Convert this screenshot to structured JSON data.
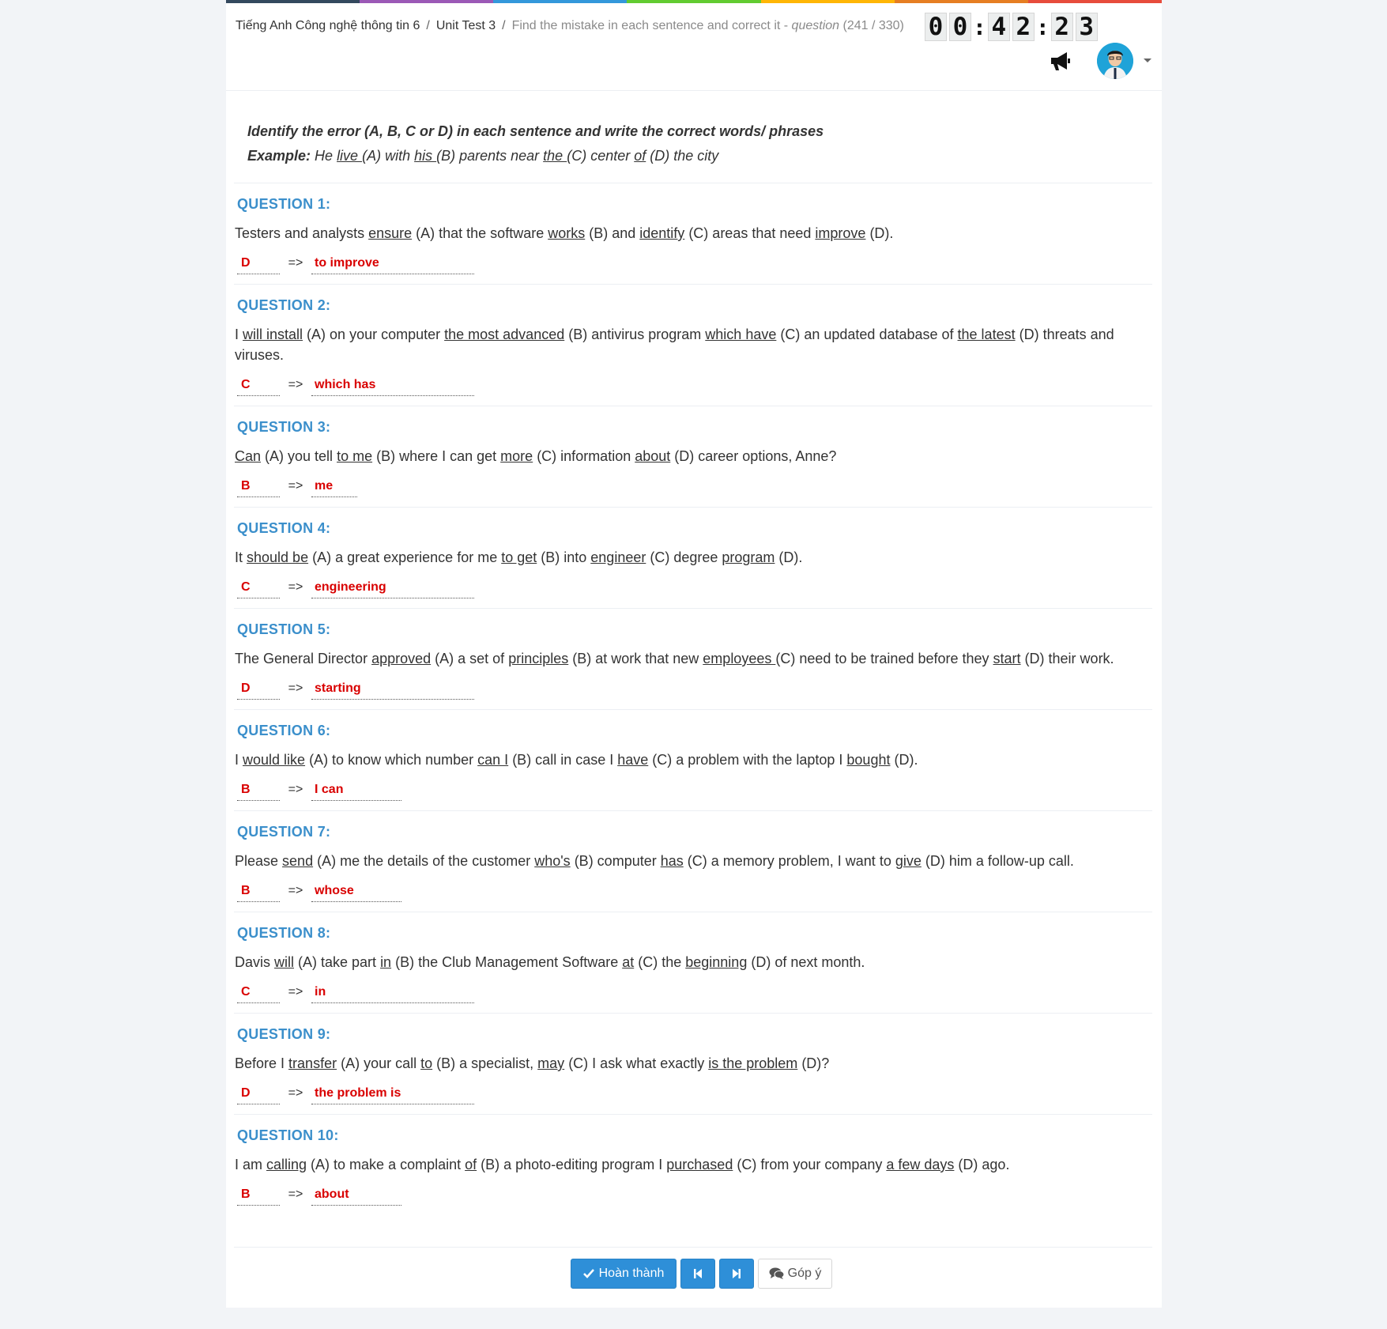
{
  "header": {
    "rainbow_colors": [
      "#34495e",
      "#9b59b6",
      "#3498db",
      "#62cb31",
      "#ffb606",
      "#e67e22",
      "#e74c3c"
    ],
    "breadcrumb": {
      "course": "Tiếng Anh Công nghệ thông tin 6",
      "unit": "Unit Test 3",
      "section": "Find the mistake in each sentence and correct it -",
      "section_italic": "question",
      "progress": "(241 / 330)"
    },
    "timer": {
      "hours": "00",
      "minutes": "42",
      "seconds": "23"
    }
  },
  "instructions": {
    "heading": "Identify the error (A, B, C or D) in each sentence and write the correct words/ phrases",
    "example_label": "Example:"
  },
  "questions": [
    {
      "title": "QUESTION 1:",
      "answer_letter": "D",
      "arrow": "=>",
      "answer_text": "to improve"
    },
    {
      "title": "QUESTION 2:",
      "answer_letter": "C",
      "arrow": "=>",
      "answer_text": "which has"
    },
    {
      "title": "QUESTION 3:",
      "answer_letter": "B",
      "arrow": "=>",
      "answer_text": "me"
    },
    {
      "title": "QUESTION 4:",
      "answer_letter": "C",
      "arrow": "=>",
      "answer_text": "engineering"
    },
    {
      "title": "QUESTION 5:",
      "answer_letter": "D",
      "arrow": "=>",
      "answer_text": "starting"
    },
    {
      "title": "QUESTION 6:",
      "answer_letter": "B",
      "arrow": "=>",
      "answer_text": "I can"
    },
    {
      "title": "QUESTION 7:",
      "answer_letter": "B",
      "arrow": "=>",
      "answer_text": "whose"
    },
    {
      "title": "QUESTION 8:",
      "answer_letter": "C",
      "arrow": "=>",
      "answer_text": "in"
    },
    {
      "title": "QUESTION 9:",
      "answer_letter": "D",
      "arrow": "=>",
      "answer_text": "the problem is"
    },
    {
      "title": "QUESTION 10:",
      "answer_letter": "B",
      "arrow": "=>",
      "answer_text": "about"
    }
  ],
  "footer": {
    "done_label": "Hoàn thành",
    "feedback_label": "Góp ý",
    "done_icon": "check-icon",
    "prev_icon": "step-backward-icon",
    "next_icon": "step-forward-icon",
    "feedback_icon": "comments-icon"
  },
  "icons": {
    "notification": "megaphone-icon",
    "avatar": "user-avatar",
    "dropdown": "caret-down-icon"
  },
  "colors": {
    "accent": "#3b8fcb",
    "answer": "#d90000",
    "button": "#2e8fd8"
  }
}
